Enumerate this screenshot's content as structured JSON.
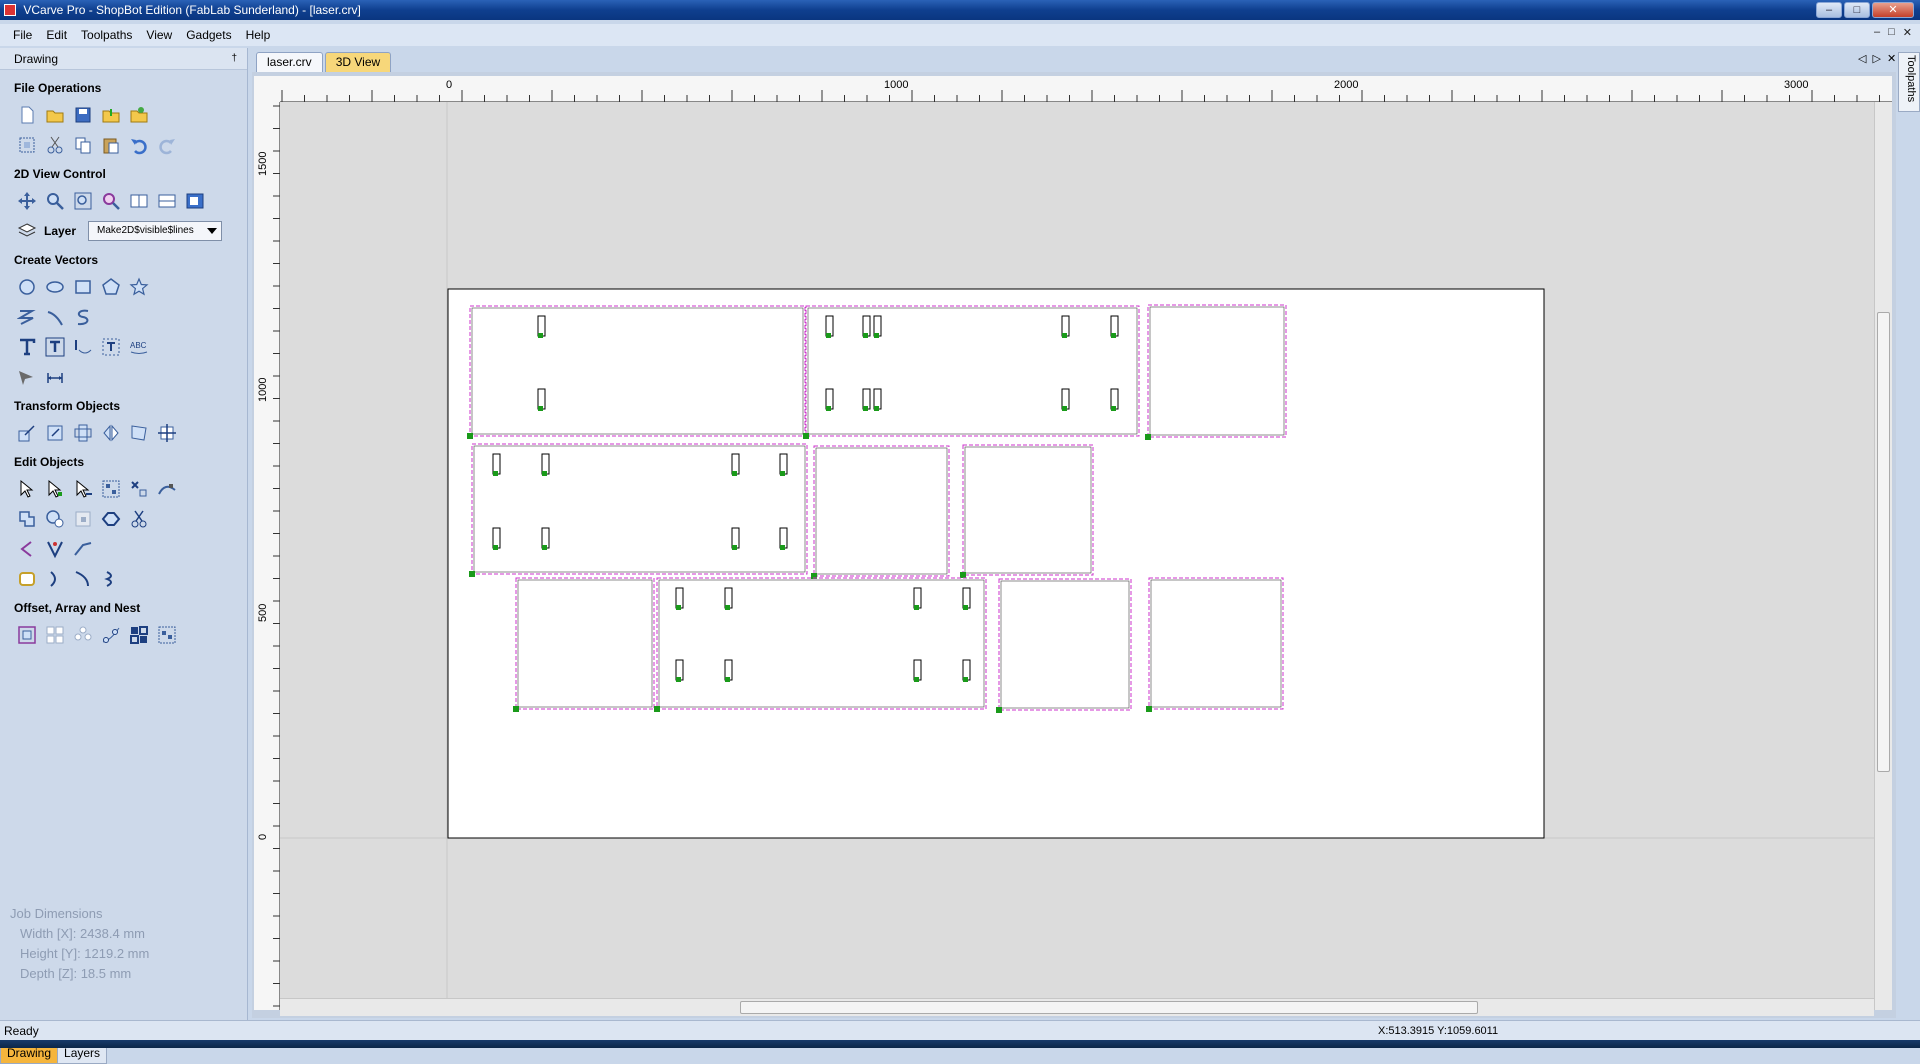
{
  "window": {
    "title": "VCarve Pro - ShopBot Edition (FabLab Sunderland) - [laser.crv]",
    "controls": {
      "minimize": "–",
      "restore": "□",
      "close": "✕"
    },
    "mdi_controls": {
      "minimize": "–",
      "restore": "□",
      "close": "✕"
    }
  },
  "menu": {
    "items": [
      "File",
      "Edit",
      "Toolpaths",
      "View",
      "Gadgets",
      "Help"
    ]
  },
  "panel": {
    "title": "Drawing",
    "pin": "†",
    "sections": {
      "file_operations": "File Operations",
      "view_control": "2D View Control",
      "create_vectors": "Create Vectors",
      "transform_objects": "Transform Objects",
      "edit_objects": "Edit Objects",
      "offset_array_nest": "Offset, Array and Nest"
    },
    "layer": {
      "label": "Layer",
      "value": "Make2D$visible$lines"
    },
    "job_dimensions": {
      "heading": "Job Dimensions",
      "width": "Width  [X]: 2438.4 mm",
      "height": "Height [Y]: 1219.2 mm",
      "depth": "Depth  [Z]: 18.5 mm"
    },
    "tabs": [
      "Drawing",
      "Layers"
    ]
  },
  "document_tabs": [
    "laser.crv",
    "3D View"
  ],
  "document_nav": {
    "prev": "◁",
    "next": "▷",
    "close": "✕"
  },
  "right_tab": "Toolpaths",
  "rulers": {
    "horizontal_labels": [
      "0",
      "1000",
      "2000",
      "3000"
    ],
    "vertical_labels": [
      "1500",
      "1000",
      "500",
      "0"
    ]
  },
  "status": {
    "text": "Ready",
    "coords": "X:513.3915 Y:1059.6011"
  },
  "colors": {
    "toolpath": "#cc33cc",
    "node": "#1a9a1a",
    "accent_tab": "#f5b53c"
  }
}
